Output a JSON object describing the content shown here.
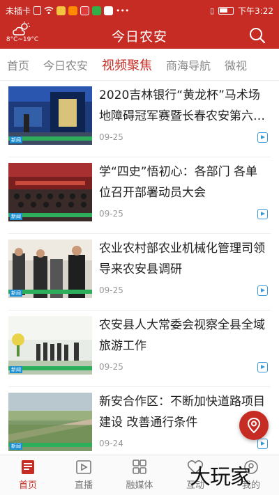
{
  "status_bar": {
    "sim_text": "未插卡",
    "time": "下午3:22",
    "icons": [
      "sim-icon",
      "wifi-icon",
      "app-notification-icons",
      "more-dots-icon",
      "vibrate-icon",
      "battery-icon"
    ]
  },
  "header": {
    "weather_temp": "8°C~19°C",
    "title": "今日农安",
    "icons": {
      "weather": "cloud-sun-icon",
      "search": "search-icon"
    }
  },
  "tabs": [
    {
      "label": "首页",
      "active": false
    },
    {
      "label": "今日农安",
      "active": false
    },
    {
      "label": "视频聚焦",
      "active": true
    },
    {
      "label": "商海导航",
      "active": false
    },
    {
      "label": "微视",
      "active": false
    }
  ],
  "news": [
    {
      "title": "2020吉林银行“黄龙杯”马术场地障碍冠军赛暨长春农安第六…",
      "date": "09-25"
    },
    {
      "title": "学“四史”悟初心：各部门 各单位召开部署动员大会",
      "date": "09-25"
    },
    {
      "title": "农业农村部农业机械化管理司领导来农安县调研",
      "date": "09-25"
    },
    {
      "title": "农安县人大常委会视察全县全域旅游工作",
      "date": "09-25"
    },
    {
      "title": "新安合作区：不断加快道路项目建设 改善通行条件",
      "date": "09-24"
    }
  ],
  "bottom_nav": [
    {
      "label": "首页",
      "icon": "home-news-icon",
      "active": true
    },
    {
      "label": "直播",
      "icon": "live-video-icon",
      "active": false
    },
    {
      "label": "融媒体",
      "icon": "grid-media-icon",
      "active": false
    },
    {
      "label": "互动",
      "icon": "interact-icon",
      "active": false
    },
    {
      "label": "我的",
      "icon": "profile-icon",
      "active": false
    }
  ],
  "watermark": "大玩家",
  "colors": {
    "brand": "#c62c24",
    "accent": "#3a9ad9"
  }
}
